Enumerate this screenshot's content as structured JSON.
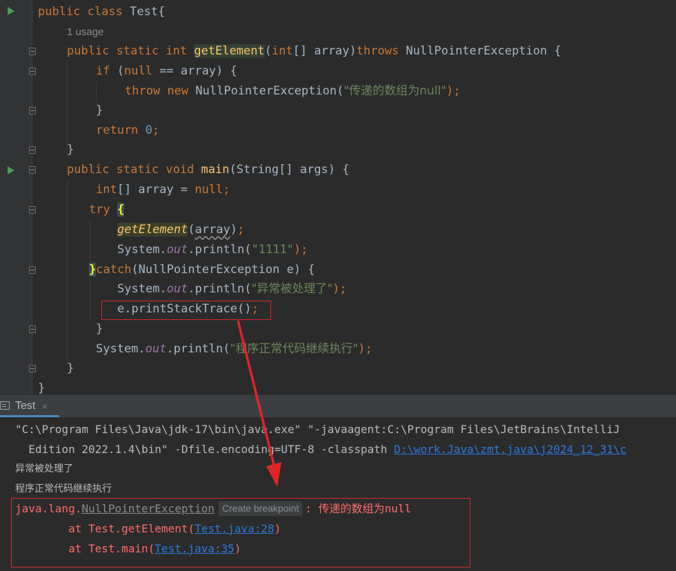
{
  "editor": {
    "lines": {
      "l1": {
        "public": "public",
        "class": "class",
        "rest": " Test{"
      },
      "usage": "1 usage",
      "l2": {
        "public": "public",
        "static": "static",
        "int": "int",
        "method": "getElement",
        "p1": "(",
        "int2": "int",
        "p2": "[] array)",
        "throws": "throws",
        "ex": " NullPointerException {"
      },
      "l3": {
        "if": "if",
        "p1": " (",
        "null": "null",
        "p2": " == array) {"
      },
      "l4": {
        "throw": "throw",
        "new": "new",
        "ex": " NullPointerException(",
        "str": "\"传递的数组为null\"",
        "end": ");"
      },
      "l5": "}",
      "l6": {
        "return": "return",
        "zero": "0",
        "semi": ";"
      },
      "l7": "}",
      "l8": {
        "public": "public",
        "static": "static",
        "void": "void",
        "method": "main",
        "rest": "(String[] args) {"
      },
      "l9": {
        "int": "int",
        "p1": "[] array = ",
        "null": "null",
        "semi": ";"
      },
      "l10": {
        "try": "try",
        "brace": "{"
      },
      "l11": {
        "call": "getElement",
        "p1": "(",
        "arg": "array",
        "p2": ")",
        "semi": ";"
      },
      "l12": {
        "sys": "System.",
        "out": "out",
        "p1": ".println(",
        "str": "\"1111\"",
        "end": ");"
      },
      "l13": {
        "brace": "}",
        "catch": "catch",
        "rest": "(NullPointerException e) {"
      },
      "l14": {
        "sys": "System.",
        "out": "out",
        "p1": ".println(",
        "str": "\"异常被处理了\"",
        "end": ");"
      },
      "l15": {
        "code": "e.printStackTrace()",
        "semi": ";"
      },
      "l16": "}",
      "l17": {
        "sys": "System.",
        "out": "out",
        "p1": ".println(",
        "str": "\"程序正常代码继续执行\"",
        "end": ");"
      },
      "l18": "}",
      "l19": "}"
    }
  },
  "run_panel": {
    "tab_label": "Test",
    "tab_close": "×",
    "console": {
      "cmd_line1": "\"C:\\Program Files\\Java\\jdk-17\\bin\\java.exe\" \"-javaagent:C:\\Program Files\\JetBrains\\IntelliJ",
      "cmd_line2_text": "  Edition 2022.1.4\\bin\" -Dfile.encoding=UTF-8 -classpath ",
      "cmd_line2_link": "D:\\work.Java\\zmt.java\\j2024_12_31\\c",
      "out1": "异常被处理了",
      "out2": "程序正常代码继续执行",
      "ex_prefix": "java.lang.",
      "ex_class": "NullPointerException",
      "create_breakpoint": "Create breakpoint",
      "ex_sep": ": ",
      "ex_msg": "传递的数组为",
      "ex_msg_tail": "null",
      "st1_prefix": "\tat Test.getElement(",
      "st1_link": "Test.java:28",
      "st1_suffix": ")",
      "st2_prefix": "\tat Test.main(",
      "st2_link": "Test.java:35",
      "st2_suffix": ")"
    }
  },
  "colors": {
    "background": "#2b2b2b",
    "keyword": "#cc7832",
    "string": "#6a8759",
    "number": "#6897bb",
    "method": "#ffc66d",
    "error": "#ff6b68",
    "link": "#287bde",
    "annotation": "#e0252a"
  }
}
